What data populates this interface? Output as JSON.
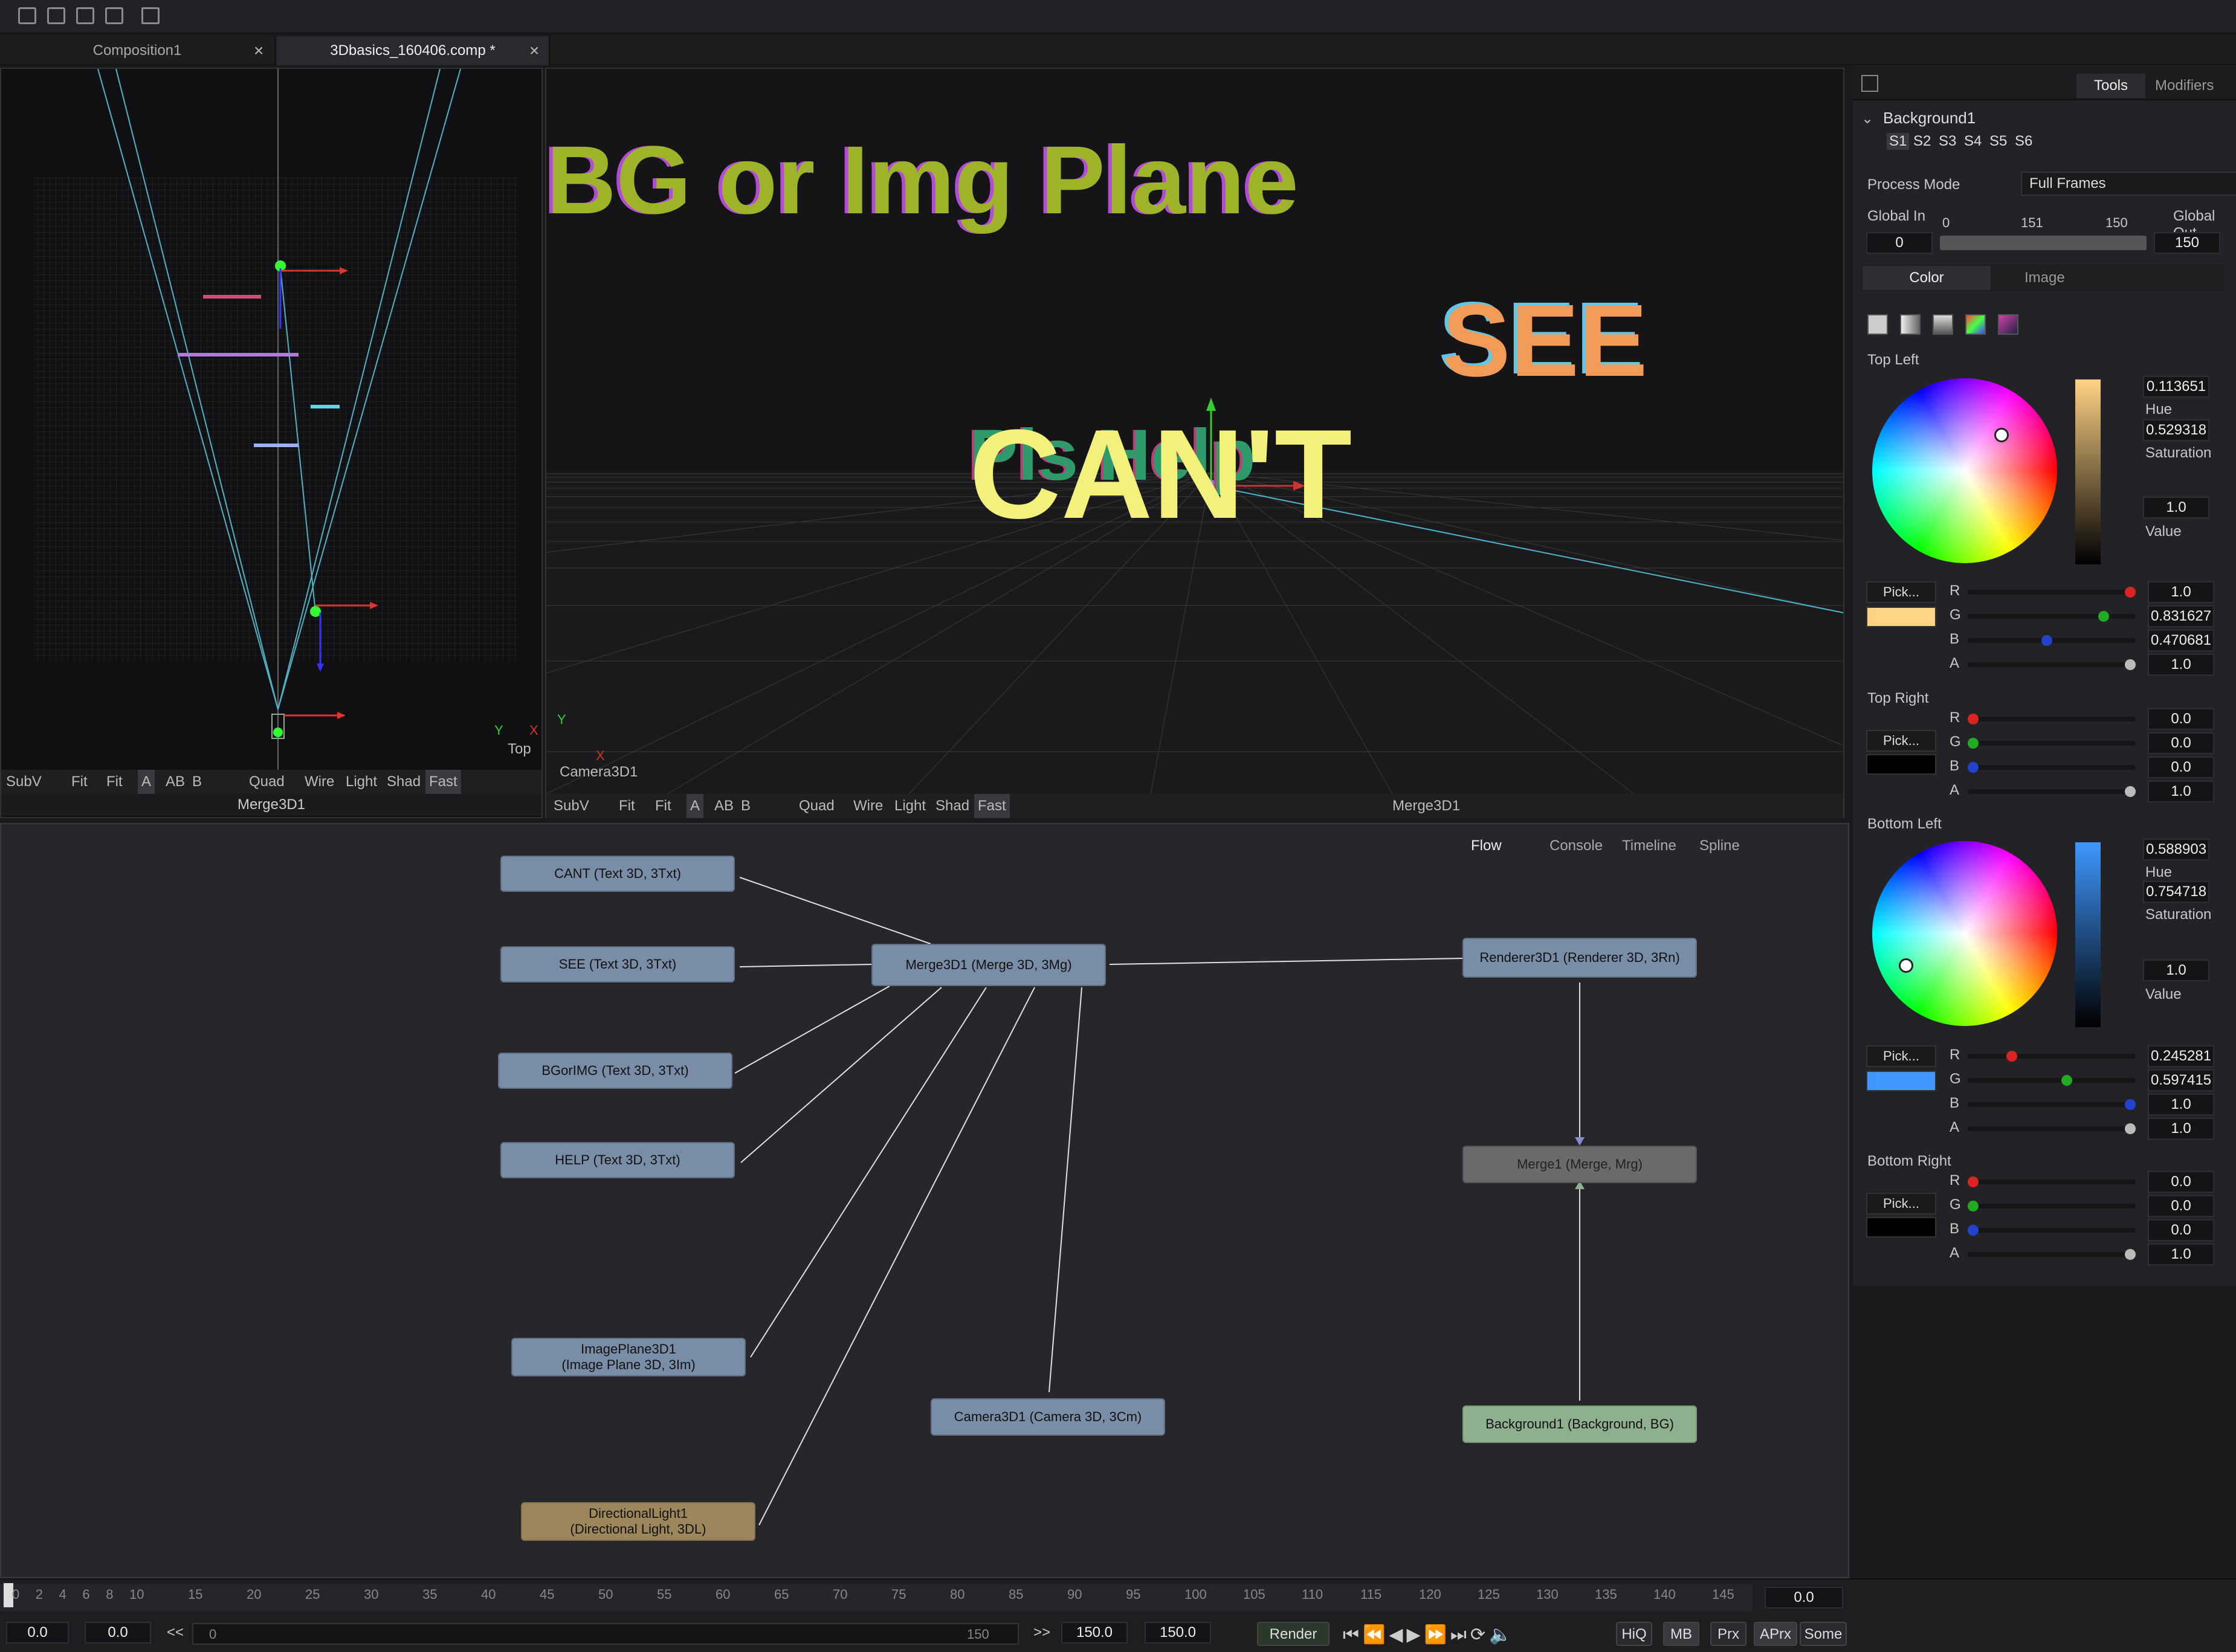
{
  "toolbar": {
    "icons": [
      "layout-1-icon",
      "layout-2-icon",
      "layout-3-icon",
      "layout-4-icon",
      "print-icon"
    ]
  },
  "tabs": [
    {
      "label": "Composition1"
    },
    {
      "label": "3Dbasics_160406.comp *"
    }
  ],
  "close_glyph": "×",
  "viewer_left": {
    "axis_y": "Y",
    "axis_x": "X",
    "view_label": "Top",
    "title": "Merge3D1",
    "bar": [
      "SubV",
      "Fit",
      "Fit",
      "A",
      "AB",
      "B",
      "Quad",
      "Wire",
      "Light",
      "Shad",
      "Fast"
    ]
  },
  "viewer_right": {
    "camera_label": "Camera3D1",
    "axis_y": "Y",
    "axis_x": "X",
    "title": "Merge3D1",
    "texts": {
      "bg": "BG or Img Plane",
      "see": "SEE",
      "cant": "CAN'T",
      "help": "Pls Help"
    },
    "bar": [
      "SubV",
      "Fit",
      "Fit",
      "A",
      "AB",
      "B",
      "Quad",
      "Wire",
      "Light",
      "Shad",
      "Fast"
    ]
  },
  "flow": {
    "tabs": [
      "Flow",
      "Console",
      "Timeline",
      "Spline"
    ],
    "nodes": {
      "cant": "CANT  (Text 3D, 3Txt)",
      "see": "SEE  (Text 3D, 3Txt)",
      "bgorimg": "BGorIMG  (Text 3D, 3Txt)",
      "help": "HELP  (Text 3D, 3Txt)",
      "merge3d": "Merge3D1  (Merge 3D, 3Mg)",
      "renderer": "Renderer3D1  (Renderer 3D, 3Rn)",
      "merge1": "Merge1  (Merge, Mrg)",
      "imageplane_1": "ImagePlane3D1",
      "imageplane_2": "(Image Plane 3D, 3Im)",
      "camera": "Camera3D1  (Camera 3D, 3Cm)",
      "background": "Background1  (Background, BG)",
      "light_1": "DirectionalLight1",
      "light_2": "(Directional Light, 3DL)"
    }
  },
  "inspector": {
    "tabs": [
      "Tools",
      "Modifiers"
    ],
    "tool_name": "Background1",
    "slots": [
      "S1",
      "S2",
      "S3",
      "S4",
      "S5",
      "S6"
    ],
    "process_mode_label": "Process Mode",
    "process_mode_value": "Full Frames",
    "global_in_label": "Global In",
    "global_out_label": "Global Out",
    "range_min": "0",
    "range_mid": "151",
    "range_max": "150",
    "global_in": "0",
    "global_out": "150",
    "subtabs": [
      "Color",
      "Image"
    ],
    "top_left": {
      "label": "Top Left",
      "hue": "0.113651",
      "hue_label": "Hue",
      "sat": "0.529318",
      "sat_label": "Saturation",
      "val": "1.0",
      "val_label": "Value",
      "pick": "Pick...",
      "swatch": "#ffd385",
      "r": "1.0",
      "g": "0.831627",
      "b": "0.470681",
      "a": "1.0"
    },
    "top_right": {
      "label": "Top Right",
      "pick": "Pick...",
      "swatch": "#000000",
      "r": "0.0",
      "g": "0.0",
      "b": "0.0",
      "a": "1.0"
    },
    "bottom_left": {
      "label": "Bottom Left",
      "hue": "0.588903",
      "hue_label": "Hue",
      "sat": "0.754718",
      "sat_label": "Saturation",
      "val": "1.0",
      "val_label": "Value",
      "pick": "Pick...",
      "swatch": "#3e98ff",
      "r": "0.245281",
      "g": "0.597415",
      "b": "1.0",
      "a": "1.0"
    },
    "bottom_right": {
      "label": "Bottom Right",
      "pick": "Pick...",
      "swatch": "#000000",
      "r": "0.0",
      "g": "0.0",
      "b": "0.0",
      "a": "1.0"
    },
    "channels": [
      "R",
      "G",
      "B",
      "A"
    ]
  },
  "timeline": {
    "ticks": [
      "0",
      "2",
      "4",
      "6",
      "8",
      "10",
      "15",
      "20",
      "25",
      "30",
      "35",
      "40",
      "45",
      "50",
      "55",
      "60",
      "65",
      "70",
      "75",
      "80",
      "85",
      "90",
      "95",
      "100",
      "105",
      "110",
      "115",
      "120",
      "125",
      "130",
      "135",
      "140",
      "145"
    ],
    "current": "0.0",
    "start": "0.0",
    "render_start": "0.0",
    "back": "<<",
    "fwd": ">>",
    "scrub_start": "0",
    "scrub_end": "150",
    "render_end": "150.0",
    "end": "150.0",
    "render": "Render",
    "hiq": "HiQ",
    "mb": "MB",
    "prx": "Prx",
    "aprx": "APrx",
    "some": "Some"
  }
}
